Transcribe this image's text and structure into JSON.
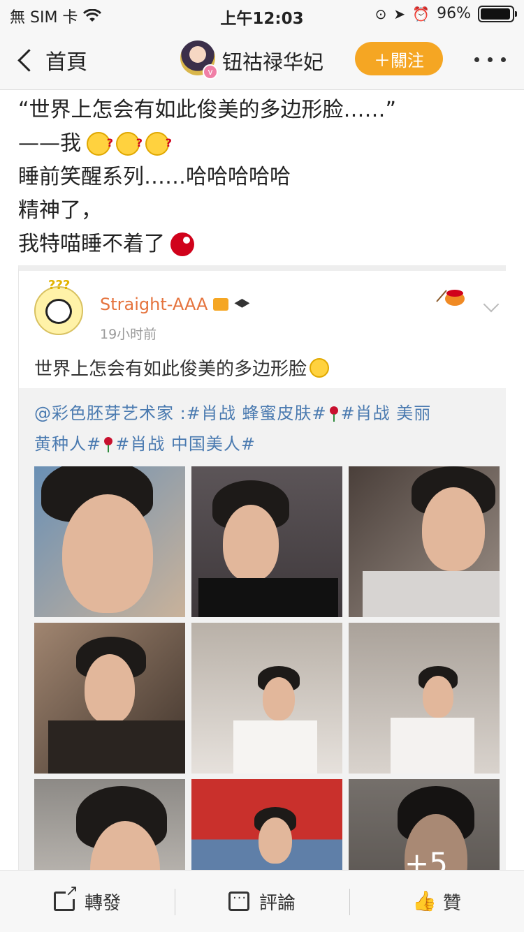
{
  "status_bar": {
    "carrier": "無 SIM 卡",
    "time": "上午12:03",
    "battery": "96%",
    "battery_level": 0.96
  },
  "nav": {
    "back_label": "首頁",
    "title": "钮祜禄华妃",
    "follow_label": "＋關注",
    "verified_badge": "v"
  },
  "post": {
    "lines": [
      "“世界上怎会有如此俊美的多边形脸……”",
      "——我",
      "睡前笑醒系列……哈哈哈哈哈",
      "精神了，",
      "我特喵睡不着了"
    ]
  },
  "embedded": {
    "username": "Straight-AAA",
    "time": "19小时前",
    "text": "世界上怎会有如此俊美的多边形脸",
    "repost_parts": [
      "@彩色胚芽艺术家 :#肖战 蜂蜜皮肤#",
      "#肖战 美丽",
      "黄种人#",
      "#肖战 中国美人#"
    ],
    "more_count": "+5",
    "photo_count_shown": 9
  },
  "toolbar": {
    "repost_label": "轉發",
    "comment_label": "評論",
    "like_label": "贊"
  },
  "colors": {
    "follow_button": "#f5a623",
    "username_orange": "#e5733d",
    "link_blue": "#4a7ab0"
  }
}
